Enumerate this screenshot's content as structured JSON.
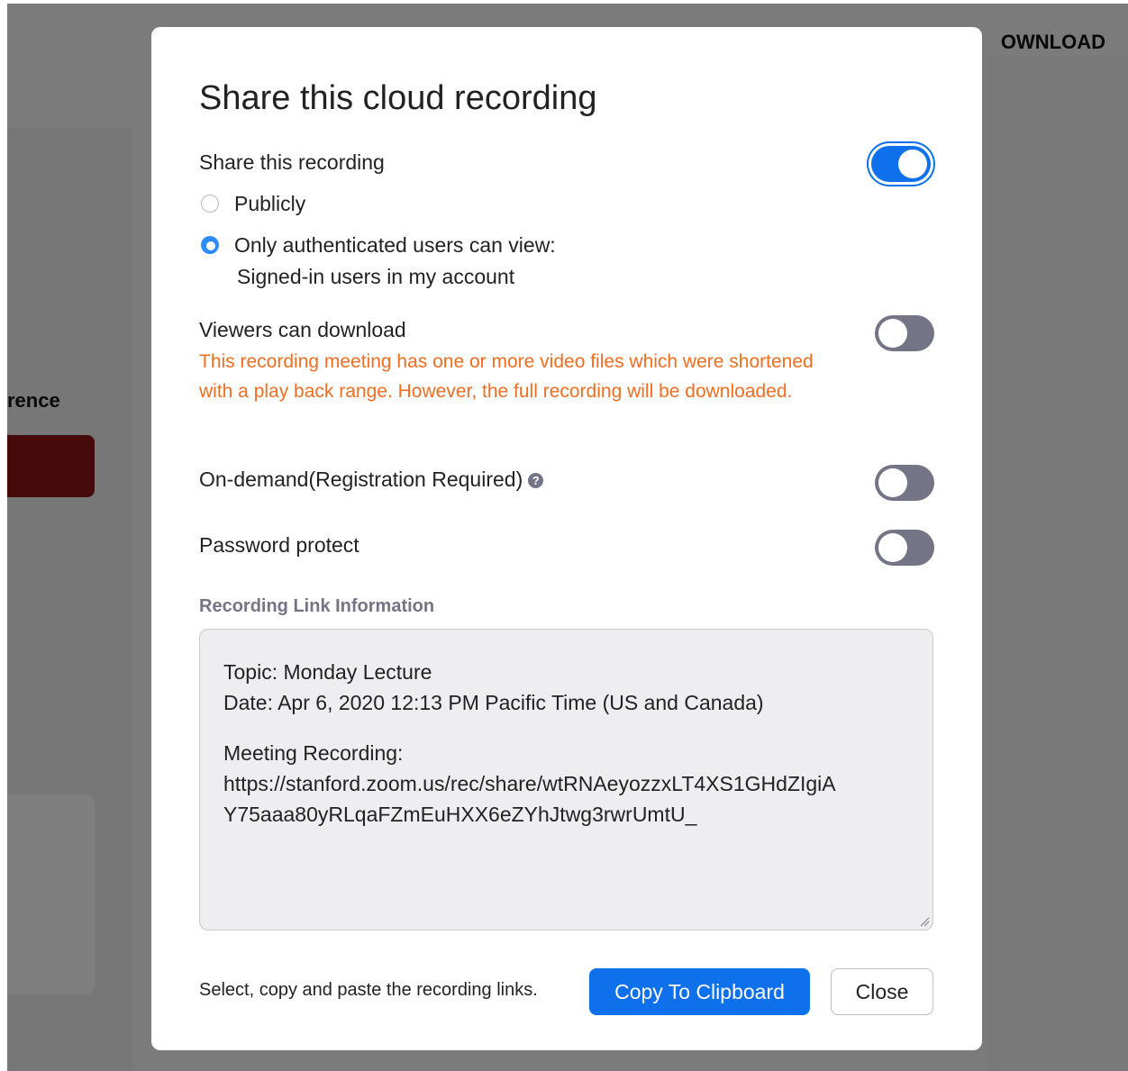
{
  "background": {
    "partial_heading": "rence",
    "partial_top_link": "OWNLOAD",
    "accent_color": "#8c1515"
  },
  "modal": {
    "title": "Share this cloud recording",
    "share_recording": {
      "label": "Share this recording",
      "enabled": true
    },
    "audience": {
      "selected": "authenticated",
      "options": [
        {
          "label": "Publicly",
          "checked": false
        },
        {
          "label": "Only authenticated users can view:",
          "checked": true,
          "sublabel": "Signed-in users in my account"
        }
      ]
    },
    "viewers_can_download": {
      "label": "Viewers can download",
      "enabled": false,
      "warning": "This recording meeting has one or more video files which were shortened with a play back range. However, the full recording will be downloaded."
    },
    "on_demand": {
      "label": "On-demand(Registration Required)",
      "enabled": false,
      "help_icon": "question-circle-icon"
    },
    "password_protect": {
      "label": "Password protect",
      "enabled": false
    },
    "link_info": {
      "section_title": "Recording Link Information",
      "topic": "Topic: Monday Lecture",
      "date": "Date: Apr 6, 2020 12:13 PM Pacific Time (US and Canada)",
      "meeting_label": "Meeting Recording:",
      "url_line1": "https://stanford.zoom.us/rec/share/wtRNAeyozzxLT4XS1GHdZIgiA",
      "url_line2": "Y75aaa80yRLqaFZmEuHXX6eZYhJtwg3rwrUmtU_"
    },
    "footer": {
      "hint": "Select, copy and paste the recording links.",
      "copy_label": "Copy To Clipboard",
      "close_label": "Close"
    },
    "colors": {
      "primary": "#0e71eb",
      "warning": "#f26d21",
      "toggle_off": "#747487"
    }
  }
}
